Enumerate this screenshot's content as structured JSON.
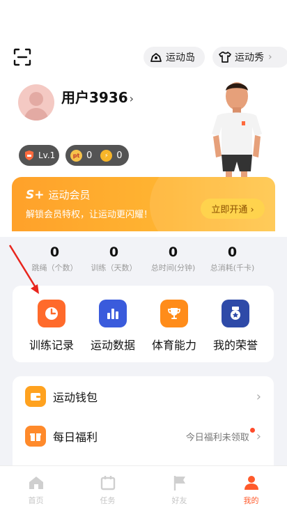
{
  "header": {
    "island_label": "运动岛",
    "show_label": "运动秀"
  },
  "profile": {
    "username": "用户3936",
    "level": "Lv.1",
    "points": "0",
    "coins": "0",
    "points_badge": "pt"
  },
  "member": {
    "title": "运动会员",
    "logo": "S+",
    "subtitle": "解锁会员特权，让运动更闪耀！",
    "button": "立即开通 ›"
  },
  "stats": [
    {
      "value": "0",
      "label": "跳绳（个数）"
    },
    {
      "value": "0",
      "label": "训练（天数）"
    },
    {
      "value": "0",
      "label": "总时间(分钟)"
    },
    {
      "value": "0",
      "label": "总消耗(千卡)"
    }
  ],
  "tools": [
    {
      "label": "训练记录",
      "icon": "clock-icon",
      "color": "#ff6a2b"
    },
    {
      "label": "运动数据",
      "icon": "bar-chart-icon",
      "color": "#3a5bdc"
    },
    {
      "label": "体育能力",
      "icon": "trophy-icon",
      "color": "#ff8c1a"
    },
    {
      "label": "我的荣誉",
      "icon": "medal-icon",
      "color": "#2e4aa8"
    }
  ],
  "list": [
    {
      "label": "运动钱包",
      "icon": "wallet-icon",
      "status": ""
    },
    {
      "label": "每日福利",
      "icon": "gift-icon",
      "status": "今日福利未领取"
    }
  ],
  "tabs": [
    {
      "label": "首页",
      "icon": "home-icon"
    },
    {
      "label": "任务",
      "icon": "calendar-icon"
    },
    {
      "label": "好友",
      "icon": "flag-icon"
    },
    {
      "label": "我的",
      "icon": "person-icon"
    }
  ],
  "colors": {
    "accent": "#ff5a2b",
    "member_gradient_start": "#ffa12a",
    "member_button": "#ffd34d"
  }
}
